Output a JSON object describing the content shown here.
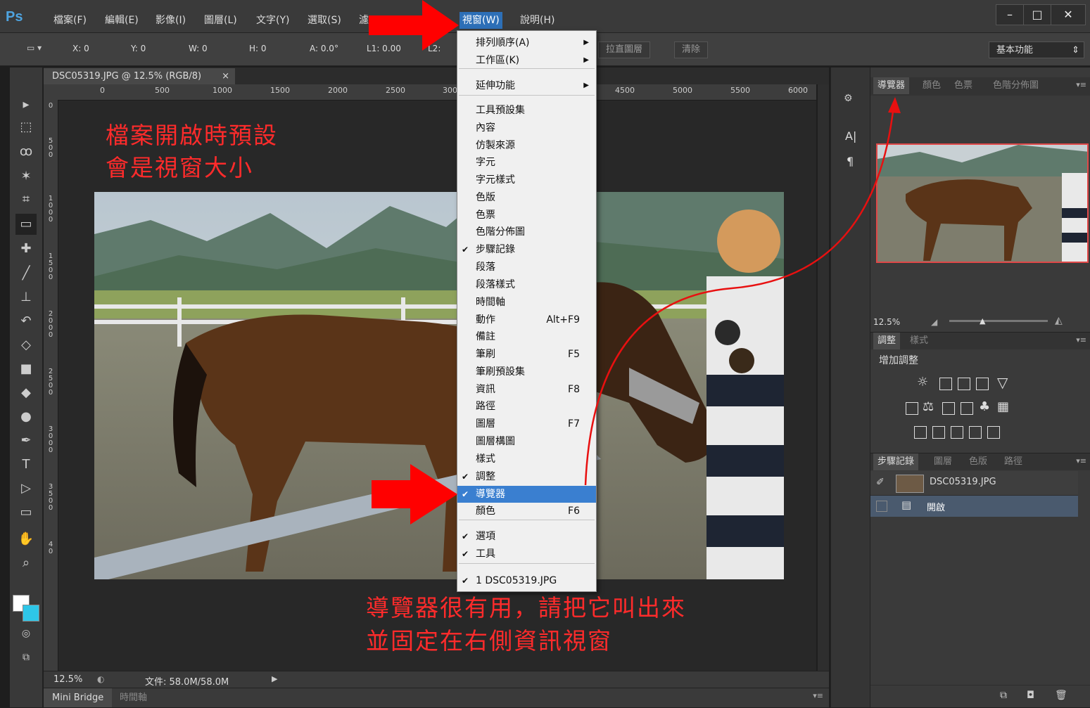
{
  "app": {
    "logo": "Ps"
  },
  "menubar": {
    "items": [
      "檔案(F)",
      "編輯(E)",
      "影像(I)",
      "圖層(L)",
      "文字(Y)",
      "選取(S)",
      "濾",
      "視窗(W)",
      "說明(H)"
    ],
    "window_controls": [
      "–",
      "□",
      "✕"
    ]
  },
  "options_bar": {
    "x": "X: 0",
    "y": "Y: 0",
    "w": "W: 0",
    "h": "H: 0",
    "angle": "A: 0.0°",
    "l1": "L1: 0.00",
    "l2": "L2:",
    "straighten_button": "拉直圖層",
    "clear_button": "清除",
    "workspace": "基本功能"
  },
  "document": {
    "tab_title": "DSC05319.JPG @ 12.5% (RGB/8)",
    "tab_close": "×",
    "ruler_ticks": [
      "0",
      "500",
      "1000",
      "1500",
      "2000",
      "2500",
      "300",
      "4500",
      "5000",
      "5500",
      "6000"
    ],
    "left_ruler": [
      "0",
      "5 0 0",
      "1 0 0 0",
      "1 5 0 0",
      "2 0 0 0",
      "2 5 0 0",
      "3 0 0 0",
      "3 5 0 0",
      "4 0"
    ]
  },
  "status": {
    "zoom": "12.5%",
    "file_info": "文件: 58.0M/58.0M"
  },
  "bottom_tabs": [
    "Mini Bridge",
    "時間軸"
  ],
  "window_menu": {
    "items": [
      {
        "label": "排列順序(A)",
        "check": "",
        "shortcut": "",
        "submenu": "▶"
      },
      {
        "label": "工作區(K)",
        "check": "",
        "shortcut": "",
        "submenu": "▶"
      },
      {
        "label": "延伸功能",
        "check": "",
        "shortcut": "",
        "submenu": "▶"
      },
      {
        "label": "工具預設集",
        "check": "",
        "shortcut": "",
        "submenu": ""
      },
      {
        "label": "內容",
        "check": "",
        "shortcut": "",
        "submenu": ""
      },
      {
        "label": "仿製來源",
        "check": "",
        "shortcut": "",
        "submenu": ""
      },
      {
        "label": "字元",
        "check": "",
        "shortcut": "",
        "submenu": ""
      },
      {
        "label": "字元樣式",
        "check": "",
        "shortcut": "",
        "submenu": ""
      },
      {
        "label": "色版",
        "check": "",
        "shortcut": "",
        "submenu": ""
      },
      {
        "label": "色票",
        "check": "",
        "shortcut": "",
        "submenu": ""
      },
      {
        "label": "色階分佈圖",
        "check": "",
        "shortcut": "",
        "submenu": ""
      },
      {
        "label": "步驟記錄",
        "check": "✔",
        "shortcut": "",
        "submenu": ""
      },
      {
        "label": "段落",
        "check": "",
        "shortcut": "",
        "submenu": ""
      },
      {
        "label": "段落樣式",
        "check": "",
        "shortcut": "",
        "submenu": ""
      },
      {
        "label": "時間軸",
        "check": "",
        "shortcut": "",
        "submenu": ""
      },
      {
        "label": "動作",
        "check": "",
        "shortcut": "Alt+F9",
        "submenu": ""
      },
      {
        "label": "備註",
        "check": "",
        "shortcut": "",
        "submenu": ""
      },
      {
        "label": "筆刷",
        "check": "",
        "shortcut": "F5",
        "submenu": ""
      },
      {
        "label": "筆刷預設集",
        "check": "",
        "shortcut": "",
        "submenu": ""
      },
      {
        "label": "資訊",
        "check": "",
        "shortcut": "F8",
        "submenu": ""
      },
      {
        "label": "路徑",
        "check": "",
        "shortcut": "",
        "submenu": ""
      },
      {
        "label": "圖層",
        "check": "",
        "shortcut": "F7",
        "submenu": ""
      },
      {
        "label": "圖層構圖",
        "check": "",
        "shortcut": "",
        "submenu": ""
      },
      {
        "label": "樣式",
        "check": "",
        "shortcut": "",
        "submenu": ""
      },
      {
        "label": "調整",
        "check": "✔",
        "shortcut": "",
        "submenu": ""
      },
      {
        "label": "導覽器",
        "check": "✔",
        "shortcut": "",
        "submenu": ""
      },
      {
        "label": "顏色",
        "check": "",
        "shortcut": "F6",
        "submenu": ""
      },
      {
        "label": "選項",
        "check": "✔",
        "shortcut": "",
        "submenu": ""
      },
      {
        "label": "工具",
        "check": "✔",
        "shortcut": "",
        "submenu": ""
      },
      {
        "label": "1 DSC05319.JPG",
        "check": "✔",
        "shortcut": "",
        "submenu": ""
      }
    ]
  },
  "dock_icons": [
    "A|",
    "¶"
  ],
  "navigator_panel": {
    "tabs": [
      "導覽器",
      "顏色",
      "色票",
      "色階分佈圖"
    ],
    "zoom": "12.5%"
  },
  "adjustments_panel": {
    "tabs": [
      "調整",
      "樣式"
    ],
    "title": "增加調整"
  },
  "history_panel": {
    "tabs": [
      "步驟記錄",
      "圖層",
      "色版",
      "路徑"
    ],
    "snapshot_name": "DSC05319.JPG",
    "step_name": "開啟"
  },
  "annotations": {
    "top_left_line1": "檔案開啟時預設",
    "top_left_line2": "會是視窗大小",
    "bottom_line1": "導覽器很有用，請把它叫出來",
    "bottom_line2": "並固定在右側資訊視窗"
  },
  "colors": {
    "accent": "#3a7fd0",
    "annotation": "#ff2b2b",
    "app_bg": "#3a3a3a"
  }
}
